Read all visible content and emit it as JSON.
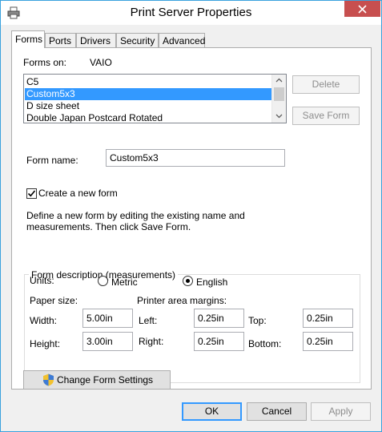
{
  "window": {
    "title": "Print Server Properties",
    "close_icon": "close-icon",
    "app_icon": "printer-icon"
  },
  "tabs": [
    {
      "label": "Forms",
      "active": true
    },
    {
      "label": "Ports",
      "active": false
    },
    {
      "label": "Drivers",
      "active": false
    },
    {
      "label": "Security",
      "active": false
    },
    {
      "label": "Advanced",
      "active": false
    }
  ],
  "forms": {
    "forms_on_label": "Forms on:",
    "server_name": "VAIO",
    "list": [
      "C5",
      "Custom5x3",
      "D size sheet",
      "Double Japan Postcard Rotated"
    ],
    "selected_index": 1,
    "delete_label": "Delete",
    "save_form_label": "Save Form",
    "form_name_label": "Form name:",
    "form_name_value": "Custom5x3",
    "create_new_label": "Create a new form",
    "create_new_checked": true,
    "instructions_line1": "Define a new form by editing the existing name and",
    "instructions_line2": "measurements. Then click Save Form."
  },
  "description": {
    "legend": "Form description (measurements)",
    "units_label": "Units:",
    "metric_label": "Metric",
    "english_label": "English",
    "selected_unit": "English",
    "paper_size_label": "Paper size:",
    "margins_label": "Printer area margins:",
    "width_label": "Width:",
    "width_value": "5.00in",
    "height_label": "Height:",
    "height_value": "3.00in",
    "left_label": "Left:",
    "left_value": "0.25in",
    "right_label": "Right:",
    "right_value": "0.25in",
    "top_label": "Top:",
    "top_value": "0.25in",
    "bottom_label": "Bottom:",
    "bottom_value": "0.25in"
  },
  "change_settings_label": "Change Form Settings",
  "change_settings_icon": "uac-shield-icon",
  "footer": {
    "ok_label": "OK",
    "cancel_label": "Cancel",
    "apply_label": "Apply"
  }
}
